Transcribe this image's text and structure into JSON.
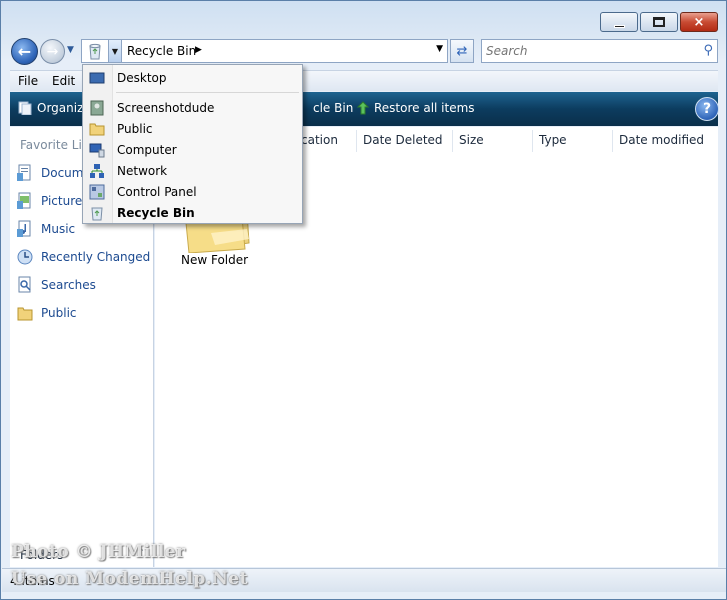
{
  "window": {
    "controls": {
      "minimize": "minimize",
      "maximize": "maximize",
      "close": "×"
    }
  },
  "address_bar": {
    "current": "Recycle Bin",
    "search_placeholder": "Search"
  },
  "menubar": {
    "file": "File",
    "edit": "Edit"
  },
  "commandbar": {
    "organize": "Organiz",
    "empty_recycle_bin": "cle Bin",
    "restore_all": "Restore all items",
    "help": "?"
  },
  "left_pane": {
    "favorites_title": "Favorite Lin",
    "items": [
      {
        "label": "Docum",
        "icon": "documents-icon"
      },
      {
        "label": "Picture",
        "icon": "pictures-icon"
      },
      {
        "label": "Music",
        "icon": "music-icon"
      },
      {
        "label": "Recently Changed",
        "icon": "recently-changed-icon"
      },
      {
        "label": "Searches",
        "icon": "searches-icon"
      },
      {
        "label": "Public",
        "icon": "public-folder-icon"
      }
    ],
    "folders_label": "Folders"
  },
  "columns": [
    "cation",
    "Date Deleted",
    "Size",
    "Type",
    "Date modified"
  ],
  "content": {
    "folder_label": "New Folder"
  },
  "status": {
    "text": "4 items"
  },
  "dropdown": {
    "items": [
      {
        "label": "Desktop",
        "icon": "desktop-icon",
        "bold": false
      },
      {
        "label": "Screenshotdude",
        "icon": "user-folder-icon",
        "bold": false
      },
      {
        "label": "Public",
        "icon": "public-folder-icon",
        "bold": false
      },
      {
        "label": "Computer",
        "icon": "computer-icon",
        "bold": false
      },
      {
        "label": "Network",
        "icon": "network-icon",
        "bold": false
      },
      {
        "label": "Control Panel",
        "icon": "control-panel-icon",
        "bold": false
      },
      {
        "label": "Recycle Bin",
        "icon": "recycle-bin-icon",
        "bold": true
      }
    ]
  },
  "watermark": {
    "line1": "Photo © JHMiller",
    "line2": "Use on ModemHelp.Net"
  },
  "colors": {
    "commandbar": "#0c3c5f",
    "link": "#1c4a90",
    "close_button": "#c84b33"
  }
}
